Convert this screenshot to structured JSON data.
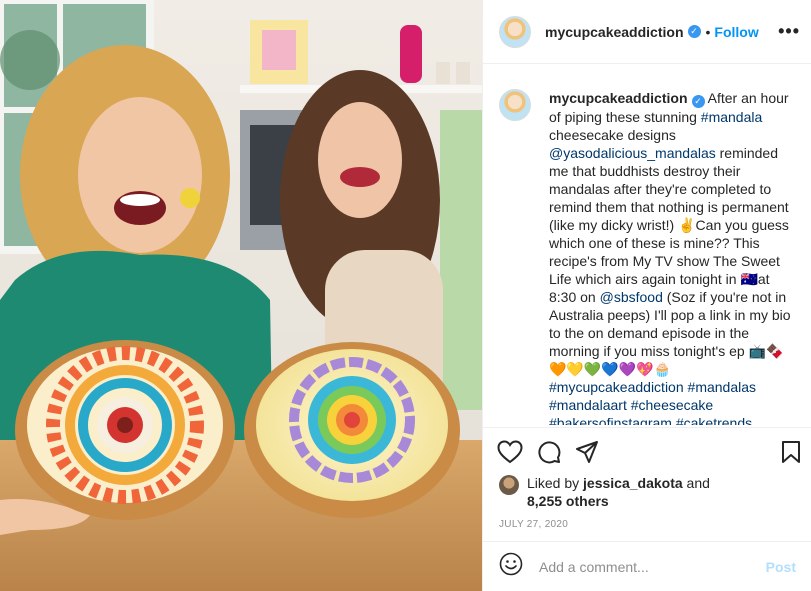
{
  "post": {
    "username": "mycupcakeaddiction",
    "dot": "•",
    "follow_label": "Follow",
    "more_label": "•••"
  },
  "caption": {
    "username": "mycupcakeaddiction",
    "part1": " After an hour of piping these stunning ",
    "tag_mandala": "#mandala",
    "part2": " cheesecake designs ",
    "mention_yasodalicious": "@yasodalicious_mandalas",
    "part3": " reminded me that buddhists destroy their mandalas after they're completed to remind them that nothing is permanent (like my dicky wrist!) ✌️Can you guess which one of these is mine?? This recipe's from My TV show The Sweet Life which airs again tonight in 🇦🇺at 8:30 on ",
    "mention_sbsfood": "@sbsfood",
    "part4": " (Soz if you're not in Australia peeps) I'll pop a link in my bio to the on demand episode in the morning if you miss tonight's ep 📺🍫🧡💛💚💙💜💖🧁 ",
    "tag_1": "#mycupcakeaddiction",
    "tag_2": "#mandalas",
    "tag_3": "#mandalaart",
    "tag_4": "#cheesecake",
    "tag_5": "#bakersofinstagram",
    "tag_6": "#caketrends"
  },
  "likes": {
    "prefix": "Liked by ",
    "user": "jessica_dakota",
    "and": " and",
    "count": "8,255 others"
  },
  "date": "JULY 27, 2020",
  "comment": {
    "placeholder": "Add a comment...",
    "post_label": "Post"
  },
  "icons": {
    "like": "heart-icon",
    "comment": "comment-icon",
    "share": "paper-plane-icon",
    "save": "bookmark-icon",
    "emoji": "emoji-icon",
    "verified": "verified-icon"
  },
  "colors": {
    "link": "#00376b",
    "follow": "#0095f6",
    "verified": "#3897f0",
    "muted": "#8e8e8e",
    "post_disabled": "#b2dffc"
  }
}
